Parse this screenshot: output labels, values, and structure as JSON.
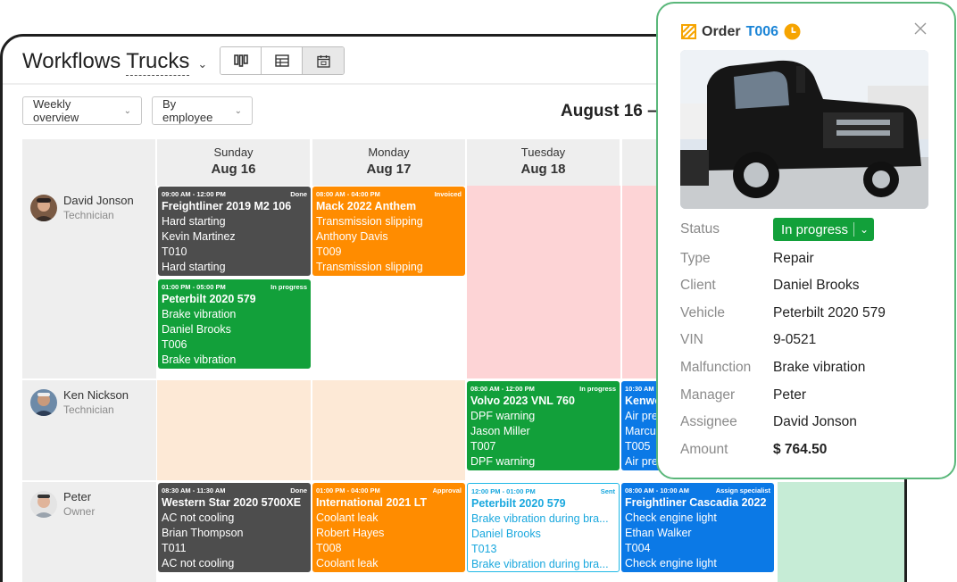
{
  "app": {
    "title_prefix": "Workflows",
    "title_entity": "Trucks"
  },
  "filters": {
    "overview": "Weekly overview",
    "group": "By employee"
  },
  "week_title": "August 16 –",
  "days": [
    {
      "name": "Sunday",
      "date": "Aug 16"
    },
    {
      "name": "Monday",
      "date": "Aug 17"
    },
    {
      "name": "Tuesday",
      "date": "Aug 18"
    }
  ],
  "employees": [
    {
      "name": "David Jonson",
      "role": "Technician"
    },
    {
      "name": "Ken Nickson",
      "role": "Technician"
    },
    {
      "name": "Peter",
      "role": "Owner"
    }
  ],
  "cards": [
    {
      "time": "09:00 AM - 12:00 PM",
      "status": "Done",
      "title": "Freightliner 2019 M2 106",
      "lines": [
        "Hard starting",
        "Kevin Martinez",
        "T010",
        "Hard starting"
      ]
    },
    {
      "time": "01:00 PM - 05:00 PM",
      "status": "In progress",
      "title": "Peterbilt 2020 579",
      "lines": [
        "Brake vibration",
        "Daniel Brooks",
        "T006",
        "Brake vibration"
      ]
    },
    {
      "time": "08:00 AM - 04:00 PM",
      "status": "Invoiced",
      "title": "Mack 2022 Anthem",
      "lines": [
        "Transmission slipping",
        "Anthony Davis",
        "T009",
        "Transmission slipping"
      ]
    },
    {
      "time": "08:00 AM - 12:00 PM",
      "status": "In progress",
      "title": "Volvo 2023 VNL 760",
      "lines": [
        "DPF warning",
        "Jason Miller",
        "T007",
        "DPF warning"
      ]
    },
    {
      "time": "10:30 AM",
      "status": "",
      "title": "Kenwo",
      "lines": [
        "Air pre",
        "Marcu",
        "T005",
        "Air pre"
      ]
    },
    {
      "time": "08:30 AM - 11:30 AM",
      "status": "Done",
      "title": "Western Star 2020 5700XE",
      "lines": [
        "AC not cooling",
        "Brian Thompson",
        "T011",
        "AC not cooling"
      ]
    },
    {
      "time": "01:00 PM - 04:00 PM",
      "status": "Approval",
      "title": "International 2021 LT",
      "lines": [
        "Coolant leak",
        "Robert Hayes",
        "T008",
        "Coolant leak"
      ]
    },
    {
      "time": "12:00 PM - 01:00 PM",
      "status": "Sent",
      "title": "Peterbilt 2020 579",
      "lines": [
        "Brake vibration during bra...",
        "Daniel Brooks",
        "T013",
        "Brake vibration during bra..."
      ]
    },
    {
      "time": "08:00 AM - 10:00 AM",
      "status": "Assign specialist",
      "title": "Freightliner Cascadia 2022",
      "lines": [
        "Check engine light",
        "Ethan Walker",
        "T004",
        "Check engine light"
      ]
    }
  ],
  "popup": {
    "order_label": "Order",
    "order_id": "T006",
    "rows": [
      {
        "label": "Status",
        "value": "In progress"
      },
      {
        "label": "Type",
        "value": "Repair"
      },
      {
        "label": "Client",
        "value": "Daniel Brooks"
      },
      {
        "label": "Vehicle",
        "value": "Peterbilt 2020 579"
      },
      {
        "label": "VIN",
        "value": "9-0521"
      },
      {
        "label": "Malfunction",
        "value": "Brake vibration"
      },
      {
        "label": "Manager",
        "value": "Peter"
      },
      {
        "label": "Assignee",
        "value": "David Jonson"
      },
      {
        "label": "Amount",
        "value": "$ 764.50"
      }
    ]
  },
  "colors": {
    "done": "#4d4d4d",
    "invoiced": "#ff8c00",
    "in_progress": "#12a03a",
    "blue": "#0b79e6",
    "sent_outline": "#1fb8e6",
    "popup_border": "#5ab77a",
    "order_link": "#1a84d6"
  },
  "icons": {
    "order_type": "order-icon",
    "order_status": "clock-icon",
    "close": "close-icon",
    "views": [
      "kanban-view-icon",
      "table-view-icon",
      "calendar-view-icon"
    ]
  }
}
